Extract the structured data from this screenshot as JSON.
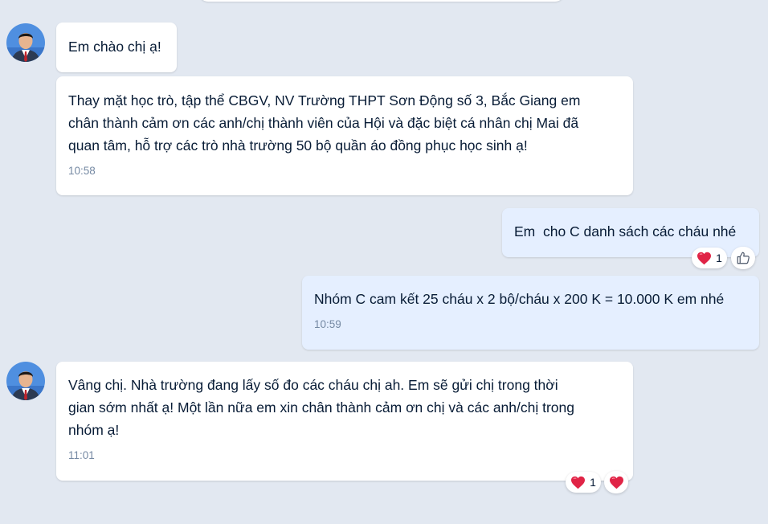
{
  "messages": [
    {
      "sender": "other",
      "text": "Em chào chị ạ!"
    },
    {
      "sender": "other",
      "text": "Thay mặt học trò, tập thể CBGV, NV Trường THPT Sơn Động số 3, Bắc Giang em\nchân thành cảm ơn các anh/chị thành viên của Hội và đặc biệt cá nhân chị Mai đã\nquan tâm, hỗ trợ các trò nhà trường 50 bộ quần áo đồng phục học sinh ạ!",
      "time": "10:58"
    },
    {
      "sender": "me",
      "text": "Em  cho C danh sách các cháu nhé",
      "reaction_count": "1",
      "reaction_icon": "heart-icon",
      "like_icon": "thumbs-up-icon"
    },
    {
      "sender": "me",
      "text": "Nhóm C cam kết 25 cháu x 2 bộ/cháu x 200 K = 10.000 K em nhé",
      "time": "10:59"
    },
    {
      "sender": "other",
      "text": "Vâng chị. Nhà trường đang lấy số đo các cháu chị ah. Em sẽ gửi chị trong thời\ngian sớm nhất ạ! Một lần nữa em xin chân thành cảm ơn chị và các anh/chị trong\nnhóm ạ!",
      "time": "11:01",
      "reaction_count": "1",
      "reaction_icon": "heart-icon"
    }
  ],
  "colors": {
    "background": "#e2e8f1",
    "bubble_other": "#ffffff",
    "bubble_mine": "#e5efff",
    "text": "#081c36",
    "time": "#7589a3",
    "heart": "#e02446"
  }
}
